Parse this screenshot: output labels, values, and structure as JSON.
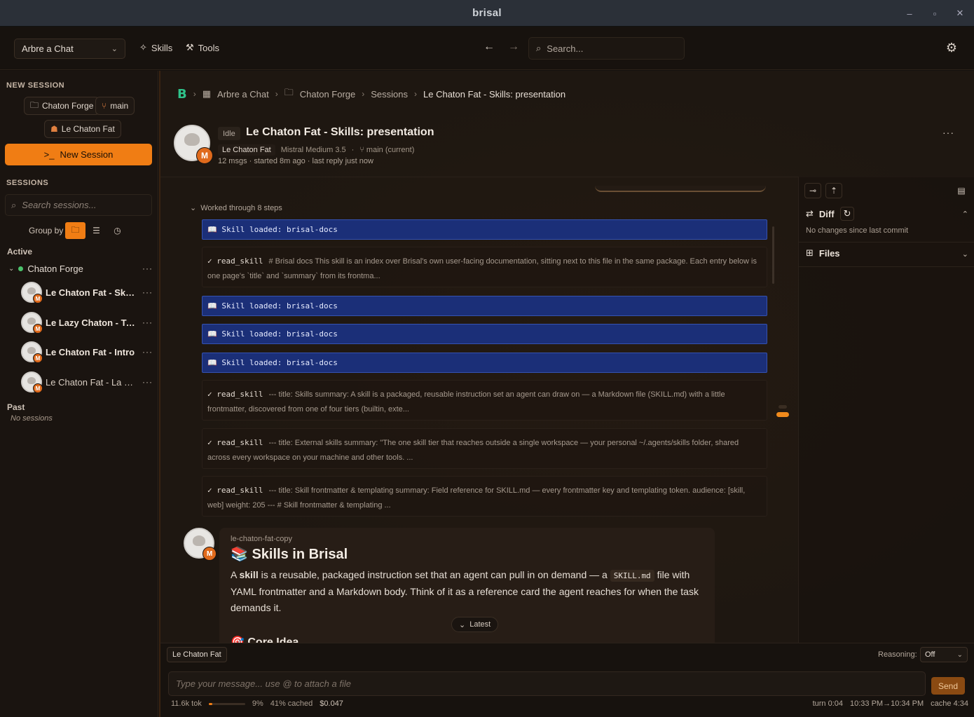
{
  "window": {
    "title": "brisal",
    "controls": [
      "–",
      "▫",
      "✕"
    ]
  },
  "toolbar": {
    "workspace": "Arbre a Chat",
    "skills_label": "Skills",
    "tools_label": "Tools",
    "search_placeholder": "Search..."
  },
  "sidebar": {
    "new_session_label": "NEW SESSION",
    "chip_folder": "Chaton Forge",
    "chip_branch": "main",
    "chip_agent": "Le Chaton Fat",
    "new_session_button": "New Session",
    "sessions_label": "SESSIONS",
    "search_placeholder": "Search sessions...",
    "group_by_label": "Group by",
    "active_label": "Active",
    "folder_name": "Chaton Forge",
    "sessions": [
      {
        "name": "Le Chaton Fat - Skill..."
      },
      {
        "name": "Le Lazy Chaton - To..."
      },
      {
        "name": "Le Chaton Fat - Intro"
      },
      {
        "name": "Le Chaton Fat - La Fo..."
      }
    ],
    "past_label": "Past",
    "no_sessions": "No sessions"
  },
  "breadcrumb": {
    "items": [
      "Arbre a Chat",
      "Chaton Forge",
      "Sessions",
      "Le Chaton Fat - Skills: presentation"
    ]
  },
  "session": {
    "status": "Idle",
    "title": "Le Chaton Fat - Skills: presentation",
    "agent": "Le Chaton Fat",
    "model": "Mistral Medium 3.5",
    "branch": "main (current)",
    "meta": "12 msgs · started 8m ago · last reply just now",
    "avatar_badge": "M"
  },
  "steps": {
    "header": "Worked through 8 steps",
    "skill_loaded": "📖 Skill loaded: brisal-docs",
    "read_tag": "✓ read_skill",
    "reads": [
      {
        "text": "# Brisal docs This skill is an index over Brisal's own user-facing documentation, sitting next to this file in the same package. Each entry below is one page's `title` and `summary` from its frontma..."
      },
      {
        "text": "--- title: Skills summary: A skill is a packaged, reusable instruction set an agent can draw on — a Markdown file (SKILL.md) with a little frontmatter, discovered from one of four tiers (builtin, exte..."
      },
      {
        "text": "--- title: External skills summary: \"The one skill tier that reaches outside a single workspace — your personal ~/.agents/skills folder, shared across every workspace on your machine and other tools. ..."
      },
      {
        "text": "--- title: Skill frontmatter & templating summary: Field reference for SKILL.md — every frontmatter key and templating token. audience: [skill, web] weight: 205 --- # Skill frontmatter & templating ..."
      }
    ]
  },
  "message": {
    "author": "le-chaton-fat-copy",
    "heading": "📚 Skills in Brisal",
    "body_a": "A ",
    "body_bold": "skill",
    "body_b": " is a reusable, packaged instruction set that an agent can pull in on demand — a ",
    "body_code": "SKILL.md",
    "body_c": " file with YAML frontmatter and a Markdown body. Think of it as a reference card the agent reaches for when the task demands it.",
    "heading2": "🎯 Core Idea",
    "latest_label": "Latest"
  },
  "right_panel": {
    "diff_label": "Diff",
    "diff_note": "No changes since last commit",
    "files_label": "Files"
  },
  "composer": {
    "agent_chip": "Le Chaton Fat",
    "reasoning_label": "Reasoning:",
    "reasoning_value": "Off",
    "placeholder": "Type your message... use @ to attach a file",
    "send_label": "Send",
    "tokens": "11.6k tok",
    "context_pct": "9%",
    "context_fraction": 0.09,
    "cached": "41% cached",
    "cost": "$0.047",
    "turn": "turn 0:04",
    "time_range": "10:33 PM→10:34 PM",
    "cache": "cache 4:34"
  }
}
